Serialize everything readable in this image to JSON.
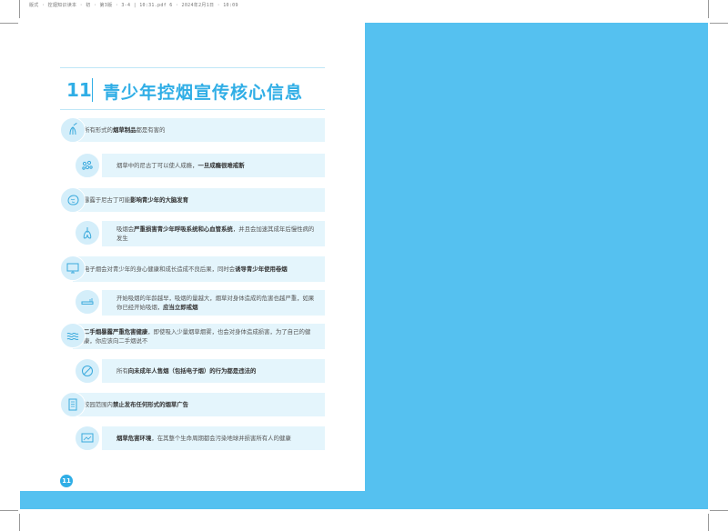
{
  "colors": {
    "accent": "#55c1f0",
    "title": "#30aee6",
    "box": "#e4f5fc"
  },
  "header": {
    "file_info": "版式 · 控烟知识读本 · 初 · 第3版 · 3-4 | 10:31.pdf 6 · 2024年2月1日 · 10:09"
  },
  "title": {
    "number": "11",
    "text": "青少年控烟宣传核心信息"
  },
  "items": [
    {
      "icon": "lungs-smoke-icon",
      "pre": "所有形式的",
      "bold": "烟草制品",
      "post": "都是有害的"
    },
    {
      "icon": "molecule-icon",
      "pre": "烟草中的尼古丁可以使人成瘾，",
      "bold": "一旦成瘾很难戒断",
      "post": ""
    },
    {
      "icon": "brain-icon",
      "pre": "暴露于尼古丁可能",
      "bold": "影响青少年的大脑发育",
      "post": ""
    },
    {
      "icon": "lungs-icon",
      "pre": "吸烟会",
      "bold": "严重损害青少年呼吸系统和心血管系统",
      "post": "，并且会加速其成年后慢性病的发生"
    },
    {
      "icon": "monitor-icon",
      "pre": "电子烟会对青少年的身心健康和成长造成不良后果，同时会",
      "bold": "诱导青少年使用卷烟",
      "post": ""
    },
    {
      "icon": "cigarette-icon",
      "pre": "开始吸烟的年龄越早，吸烟的量越大，烟草对身体造成的危害也越严重，如果你已经开始吸烟，",
      "bold": "应当立即戒烟",
      "post": ""
    },
    {
      "icon": "smoke-waves-icon",
      "pre": "",
      "bold": "二手烟暴露严重危害健康",
      "post": "，即使吸入少量烟草烟雾，也会对身体造成损害，为了自己的健康，你应该向二手烟说不"
    },
    {
      "icon": "no-sale-icon",
      "pre": "所有",
      "bold": "向未成年人售烟（包括电子烟）的行为都是违法的",
      "post": ""
    },
    {
      "icon": "document-icon",
      "pre": "校园范围内",
      "bold": "禁止发布任何形式的烟草广告",
      "post": ""
    },
    {
      "icon": "environment-icon",
      "pre": "",
      "bold": "烟草危害环境",
      "post": "，在其整个生命周期都会污染地球并损害所有人的健康"
    }
  ],
  "page_number": "11"
}
